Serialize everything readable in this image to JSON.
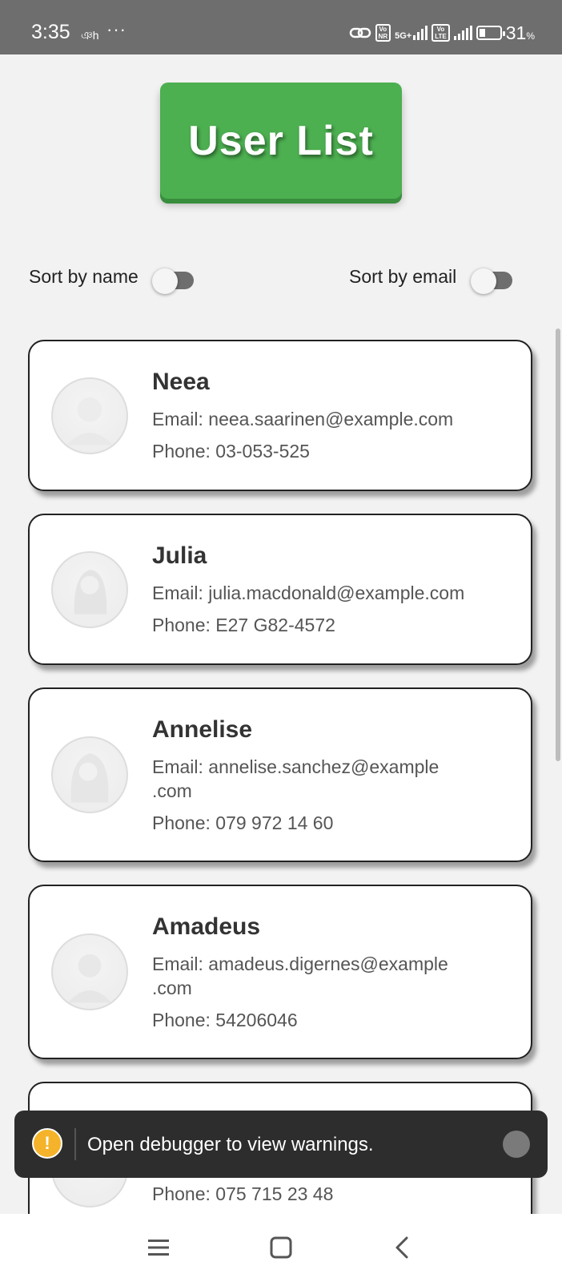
{
  "status_bar": {
    "time": "3:35",
    "sub_icon": "ঞh",
    "dots": "···",
    "volte1": "Vo\nNR",
    "net_label": "5G+",
    "volte2": "Vo\nLTE",
    "battery_level": 0.31,
    "battery_value": "31",
    "battery_unit": "%"
  },
  "header": {
    "title": "User List"
  },
  "sort": {
    "name_label": "Sort by name",
    "email_label": "Sort by email",
    "name_on": false,
    "email_on": false
  },
  "users": [
    {
      "name": "Neea",
      "email": "Email: neea.saarinen@example.com",
      "phone": "Phone: 03-053-525"
    },
    {
      "name": "Julia",
      "email": "Email: julia.macdonald@example.com",
      "phone": "Phone: E27 G82-4572"
    },
    {
      "name": "Annelise",
      "email": "Email: annelise.sanchez@example\n.com",
      "phone": "Phone: 079 972 14 60"
    },
    {
      "name": "Amadeus",
      "email": "Email: amadeus.digernes@example\n.com",
      "phone": "Phone: 54206046"
    },
    {
      "name": "",
      "email": "",
      "phone": "Phone: 075 715 23 48"
    }
  ],
  "toast": {
    "icon": "!",
    "message": "Open debugger to view warnings."
  },
  "navbar": {
    "icons": [
      "menu-icon",
      "home-square-icon",
      "back-chevron-icon"
    ]
  },
  "colors": {
    "accent": "#4caf50",
    "status_bar": "#6e6e6e",
    "toast_bg": "#2d2d2d",
    "warning": "#f4b32a"
  }
}
